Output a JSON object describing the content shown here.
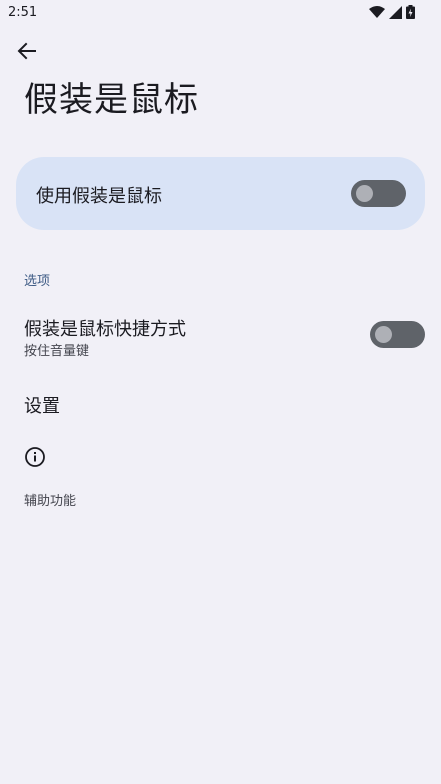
{
  "status_bar": {
    "time": "2:51",
    "icons": [
      "wifi-icon",
      "signal-icon",
      "battery-icon"
    ]
  },
  "header": {
    "back_icon": "arrow-back-icon",
    "title": "假装是鼠标"
  },
  "main_toggle": {
    "label": "使用假装是鼠标",
    "enabled": false
  },
  "options": {
    "section_title": "选项",
    "shortcut": {
      "title": "假装是鼠标快捷方式",
      "summary": "按住音量键",
      "enabled": false
    },
    "settings": {
      "title": "设置"
    }
  },
  "footer": {
    "icon": "info-icon",
    "text": "辅助功能"
  },
  "colors": {
    "background": "#f1f0f7",
    "card": "#d9e3f6",
    "accent": "#3d5a84",
    "switch_track_off": "#5f6369"
  }
}
